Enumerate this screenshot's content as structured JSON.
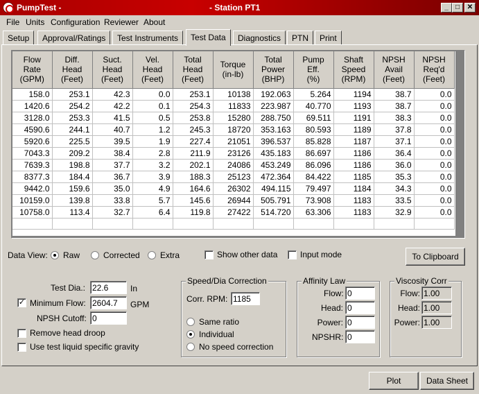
{
  "window": {
    "app_title": "PumpTest -",
    "station_title": "- Station PT1",
    "min_glyph": "_",
    "max_glyph": "□",
    "close_glyph": "✕"
  },
  "menu": [
    "File",
    "Units",
    "Configuration",
    "Reviewer",
    "About"
  ],
  "tabs": [
    "Setup",
    "Approval/Ratings",
    "Test Instruments",
    "Test Data",
    "Diagnostics",
    "PTN",
    "Print"
  ],
  "active_tab": "Test Data",
  "grid": {
    "headers": [
      [
        "Flow",
        "Rate",
        "(GPM)"
      ],
      [
        "Diff.",
        "Head",
        "(Feet)"
      ],
      [
        "Suct.",
        "Head",
        "(Feet)"
      ],
      [
        "Vel.",
        "Head",
        "(Feet)"
      ],
      [
        "Total",
        "Head",
        "(Feet)"
      ],
      [
        "Torque",
        "(in-lb)"
      ],
      [
        "Total",
        "Power",
        "(BHP)"
      ],
      [
        "Pump",
        "Eff.",
        "(%)"
      ],
      [
        "Shaft",
        "Speed",
        "(RPM)"
      ],
      [
        "NPSH",
        "Avail",
        "(Feet)"
      ],
      [
        "NPSH",
        "Req'd",
        "(Feet)"
      ]
    ],
    "rows": [
      [
        "158.0",
        "253.1",
        "42.3",
        "0.0",
        "253.1",
        "10138",
        "192.063",
        "5.264",
        "1194",
        "38.7",
        "0.0"
      ],
      [
        "1420.6",
        "254.2",
        "42.2",
        "0.1",
        "254.3",
        "11833",
        "223.987",
        "40.770",
        "1193",
        "38.7",
        "0.0"
      ],
      [
        "3128.0",
        "253.3",
        "41.5",
        "0.5",
        "253.8",
        "15280",
        "288.750",
        "69.511",
        "1191",
        "38.3",
        "0.0"
      ],
      [
        "4590.6",
        "244.1",
        "40.7",
        "1.2",
        "245.3",
        "18720",
        "353.163",
        "80.593",
        "1189",
        "37.8",
        "0.0"
      ],
      [
        "5920.6",
        "225.5",
        "39.5",
        "1.9",
        "227.4",
        "21051",
        "396.537",
        "85.828",
        "1187",
        "37.1",
        "0.0"
      ],
      [
        "7043.3",
        "209.2",
        "38.4",
        "2.8",
        "211.9",
        "23126",
        "435.183",
        "86.697",
        "1186",
        "36.4",
        "0.0"
      ],
      [
        "7639.3",
        "198.8",
        "37.7",
        "3.2",
        "202.1",
        "24086",
        "453.249",
        "86.096",
        "1186",
        "36.0",
        "0.0"
      ],
      [
        "8377.3",
        "184.4",
        "36.7",
        "3.9",
        "188.3",
        "25123",
        "472.364",
        "84.422",
        "1185",
        "35.3",
        "0.0"
      ],
      [
        "9442.0",
        "159.6",
        "35.0",
        "4.9",
        "164.6",
        "26302",
        "494.115",
        "79.497",
        "1184",
        "34.3",
        "0.0"
      ],
      [
        "10159.0",
        "139.8",
        "33.8",
        "5.7",
        "145.6",
        "26944",
        "505.791",
        "73.908",
        "1183",
        "33.5",
        "0.0"
      ],
      [
        "10758.0",
        "113.4",
        "32.7",
        "6.4",
        "119.8",
        "27422",
        "514.720",
        "63.306",
        "1183",
        "32.9",
        "0.0"
      ],
      [
        "",
        "",
        "",
        "",
        "",
        "",
        "",
        "",
        "",
        "",
        ""
      ]
    ]
  },
  "data_view": {
    "label": "Data View:",
    "options": [
      "Raw",
      "Corrected",
      "Extra"
    ],
    "selected": "Raw",
    "show_other": "Show other data",
    "input_mode": "Input mode"
  },
  "clipboard_button": "To Clipboard",
  "params": {
    "test_dia_label": "Test Dia.:",
    "test_dia_value": "22.6",
    "test_dia_unit": "In",
    "min_flow_label": "Minimum Flow:",
    "min_flow_value": "2604.7",
    "min_flow_unit": "GPM",
    "min_flow_checked": true,
    "npsh_cutoff_label": "NPSH Cutoff:",
    "npsh_cutoff_value": "0",
    "remove_droop": "Remove head droop",
    "use_gravity": "Use test liquid specific gravity"
  },
  "speed_correction": {
    "title": "Speed/Dia Correction",
    "corr_rpm_label": "Corr. RPM:",
    "corr_rpm_value": "1185",
    "options": [
      "Same ratio",
      "Individual",
      "No speed correction"
    ],
    "selected": "Individual"
  },
  "affinity": {
    "title": "Affinity Law",
    "fields": [
      {
        "label": "Flow:",
        "value": "0"
      },
      {
        "label": "Head:",
        "value": "0"
      },
      {
        "label": "Power:",
        "value": "0"
      },
      {
        "label": "NPSHR:",
        "value": "0"
      }
    ]
  },
  "viscosity": {
    "title": "Viscosity Corr",
    "fields": [
      {
        "label": "Flow:",
        "value": "1.00"
      },
      {
        "label": "Head:",
        "value": "1.00"
      },
      {
        "label": "Power:",
        "value": "1.00"
      }
    ]
  },
  "bottom_buttons": {
    "plot": "Plot",
    "data_sheet": "Data Sheet"
  }
}
